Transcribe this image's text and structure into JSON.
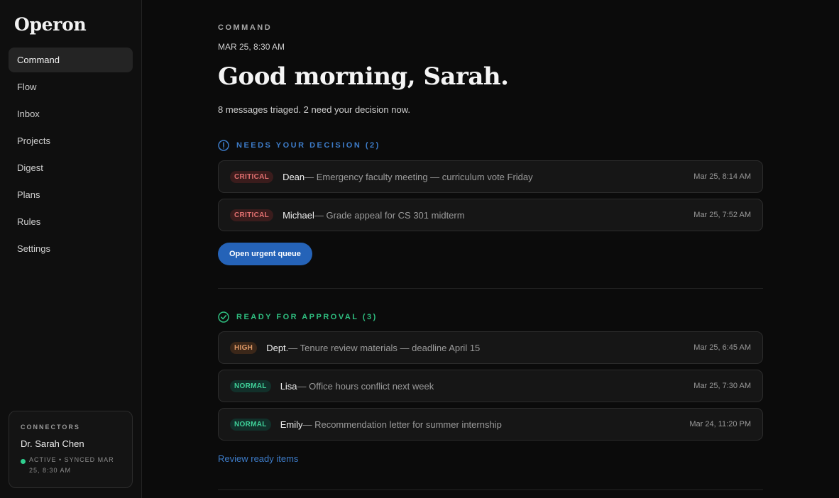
{
  "app": {
    "name": "Operon"
  },
  "sidebar": {
    "items": [
      {
        "label": "Command",
        "active": true
      },
      {
        "label": "Flow"
      },
      {
        "label": "Inbox"
      },
      {
        "label": "Projects"
      },
      {
        "label": "Digest"
      },
      {
        "label": "Plans"
      },
      {
        "label": "Rules"
      },
      {
        "label": "Settings"
      }
    ],
    "connectors": {
      "label": "CONNECTORS",
      "name": "Dr. Sarah Chen",
      "status": "ACTIVE • SYNCED MAR 25, 8:30 AM",
      "status_color": "#2fcf8f"
    }
  },
  "main": {
    "section_label": "COMMAND",
    "timestamp": "MAR 25, 8:30 AM",
    "greeting": "Good morning, Sarah.",
    "summary": "8 messages triaged. 2 need your decision now.",
    "decision": {
      "title": "NEEDS YOUR DECISION (2)",
      "icon": "alert-circle-icon",
      "color": "#3d7cc9",
      "items": [
        {
          "badge": "CRITICAL",
          "sender": "Dean",
          "subject": " — Emergency faculty meeting — curriculum vote Friday",
          "time": "Mar 25, 8:14 AM"
        },
        {
          "badge": "CRITICAL",
          "sender": "Michael",
          "subject": " — Grade appeal for CS 301 midterm",
          "time": "Mar 25, 7:52 AM"
        }
      ],
      "action": "Open urgent queue"
    },
    "approval": {
      "title": "READY FOR APPROVAL (3)",
      "icon": "check-circle-icon",
      "color": "#2fbf80",
      "items": [
        {
          "badge": "HIGH",
          "sender": "Dept.",
          "subject": " — Tenure review materials — deadline April 15",
          "time": "Mar 25, 6:45 AM"
        },
        {
          "badge": "NORMAL",
          "sender": "Lisa",
          "subject": " — Office hours conflict next week",
          "time": "Mar 25, 7:30 AM"
        },
        {
          "badge": "NORMAL",
          "sender": "Emily",
          "subject": " — Recommendation letter for summer internship",
          "time": "Mar 24, 11:20 PM"
        }
      ],
      "action": "Review ready items"
    }
  },
  "colors": {
    "accent": "#2563b8",
    "critical": "#e27070",
    "high": "#e09a67",
    "normal": "#3fcf98"
  }
}
